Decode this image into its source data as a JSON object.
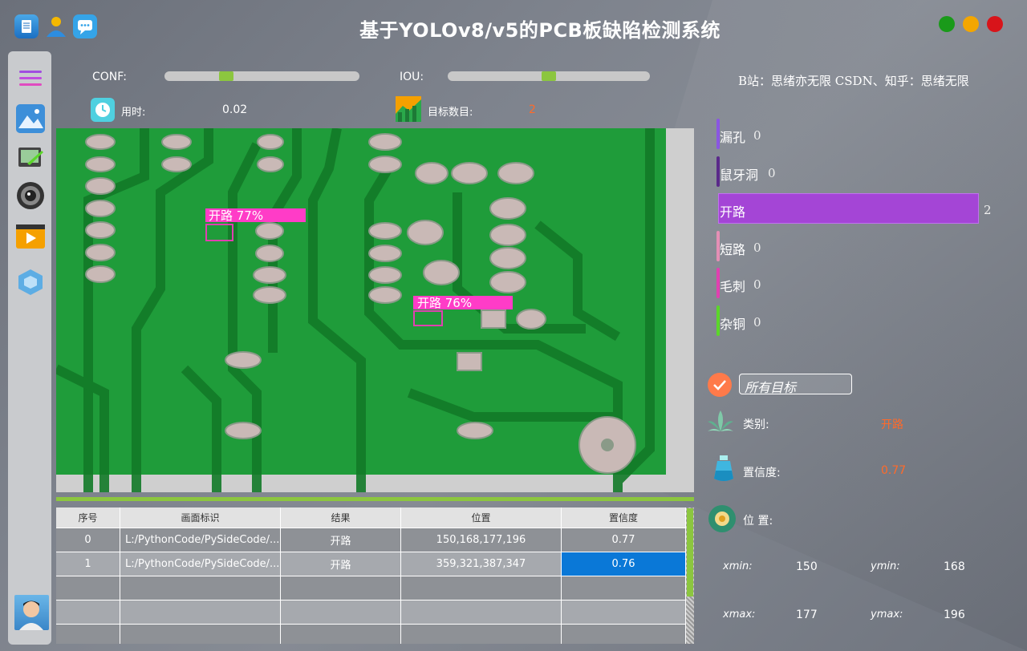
{
  "app": {
    "title": "基于YOLOv8/v5的PCB板缺陷检测系统"
  },
  "colors": {
    "accent_green": "#8cc63f",
    "value_red": "#ff6a2a",
    "bar_purple": "#a445d6",
    "win_green": "#1a9a1a",
    "win_yellow": "#f3a600",
    "win_red": "#d8141a"
  },
  "controls": {
    "conf_label": "CONF:",
    "conf_value": 0.3,
    "iou_label": "IOU:",
    "iou_value": 0.5,
    "time_label": "用时:",
    "time_value": "0.02",
    "count_label": "目标数目:",
    "count_value": "2"
  },
  "credit": "B站：思绪亦无限  CSDN、知乎：思绪无限",
  "image": {
    "detections": [
      {
        "label": "开路 77%"
      },
      {
        "label": "开路 76%"
      }
    ]
  },
  "table": {
    "headers": [
      "序号",
      "画面标识",
      "结果",
      "位置",
      "置信度"
    ],
    "rows": [
      [
        "0",
        "L:/PythonCode/PySideCode/...",
        "开路",
        "150,168,177,196",
        "0.77"
      ],
      [
        "1",
        "L:/PythonCode/PySideCode/...",
        "开路",
        "359,321,387,347",
        "0.76"
      ]
    ]
  },
  "stats": {
    "items": [
      {
        "label": "漏孔",
        "count": "0",
        "color": "#8a56e2"
      },
      {
        "label": "鼠牙洞",
        "count": "0",
        "color": "#5a2a8a"
      },
      {
        "label": "开路",
        "count": "2",
        "color": "#a445d6"
      },
      {
        "label": "短路",
        "count": "0",
        "color": "#e48fb5"
      },
      {
        "label": "毛刺",
        "count": "0",
        "color": "#e040b0"
      },
      {
        "label": "杂铜",
        "count": "0",
        "color": "#5bd62a"
      }
    ]
  },
  "detail": {
    "target_select": "所有目标",
    "class_label": "类别:",
    "class_value": "开路",
    "conf_label": "置信度:",
    "conf_value": "0.77",
    "pos_label": "位 置:",
    "xmin_label": "xmin:",
    "xmin": "150",
    "ymin_label": "ymin:",
    "ymin": "168",
    "xmax_label": "xmax:",
    "xmax": "177",
    "ymax_label": "ymax:",
    "ymax": "196"
  }
}
